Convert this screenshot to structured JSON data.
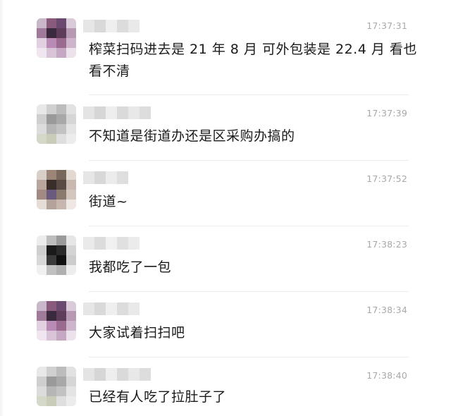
{
  "messages": [
    {
      "time": "17:37:31",
      "text": "榨菜扫码进去是 21 年 8 月  可外包装是 22.4 月 看也看不清",
      "avatar_icon": "blurred-avatar-icon"
    },
    {
      "time": "17:37:39",
      "text": "不知道是街道办还是区采购办搞的",
      "avatar_icon": "blurred-avatar-icon"
    },
    {
      "time": "17:37:52",
      "text": "街道~",
      "avatar_icon": "blurred-avatar-icon"
    },
    {
      "time": "17:38:23",
      "text": "我都吃了一包",
      "avatar_icon": "blurred-avatar-icon"
    },
    {
      "time": "17:38:34",
      "text": "大家试着扫扫吧",
      "avatar_icon": "blurred-avatar-icon"
    },
    {
      "time": "17:38:40",
      "text": "已经有人吃了拉肚子了",
      "avatar_icon": "blurred-avatar-icon"
    }
  ]
}
